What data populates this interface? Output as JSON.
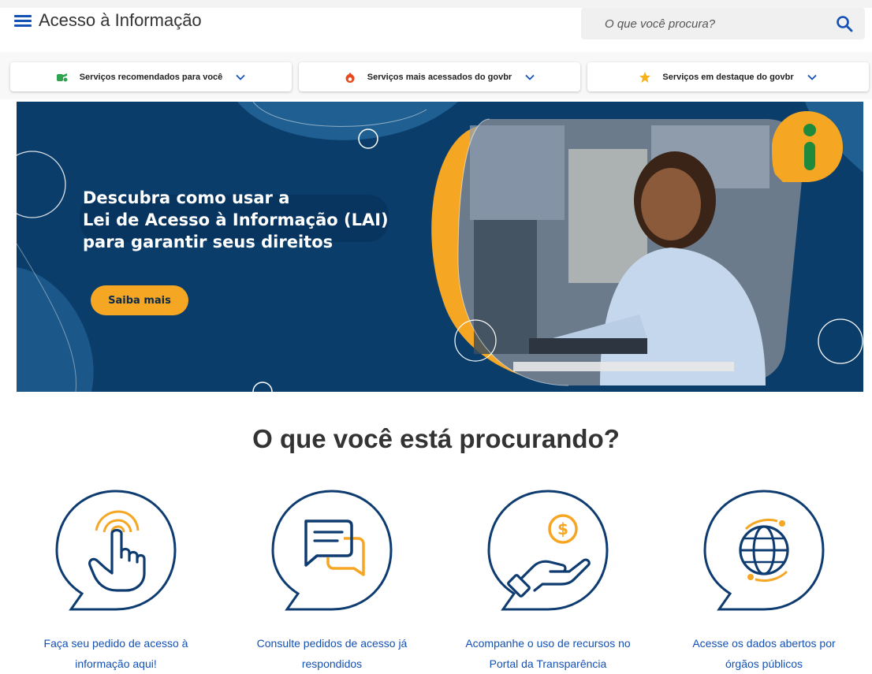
{
  "header": {
    "title": "Acesso à Informação",
    "search_placeholder": "O que você procura?"
  },
  "chips": [
    {
      "label": "Serviços recomendados para você",
      "icon": "recommended-icon"
    },
    {
      "label": "Serviços mais acessados do govbr",
      "icon": "fire-icon"
    },
    {
      "label": "Serviços em destaque do govbr",
      "icon": "star-icon"
    }
  ],
  "banner": {
    "line1": "Descubra como usar a",
    "line2": "Lei de Acesso à Informação (LAI)",
    "line3": "para garantir seus direitos",
    "cta": "Saiba mais"
  },
  "section": {
    "title": "O que você está procurando?"
  },
  "cards": [
    {
      "line1": "Faça seu pedido de acesso à",
      "line2": "informação aqui!",
      "icon": "touch-hand-icon"
    },
    {
      "line1": "Consulte pedidos de acesso já",
      "line2": "respondidos",
      "icon": "chat-bubbles-icon"
    },
    {
      "line1": "Acompanhe o uso de recursos no",
      "line2": "Portal da Transparência",
      "icon": "hand-coin-icon"
    },
    {
      "line1": "Acesse os dados abertos por",
      "line2": "órgãos públicos",
      "icon": "globe-icon"
    }
  ],
  "colors": {
    "primary": "#1351b4",
    "banner_bg": "#0b3d6b",
    "accent": "#f5a623"
  }
}
